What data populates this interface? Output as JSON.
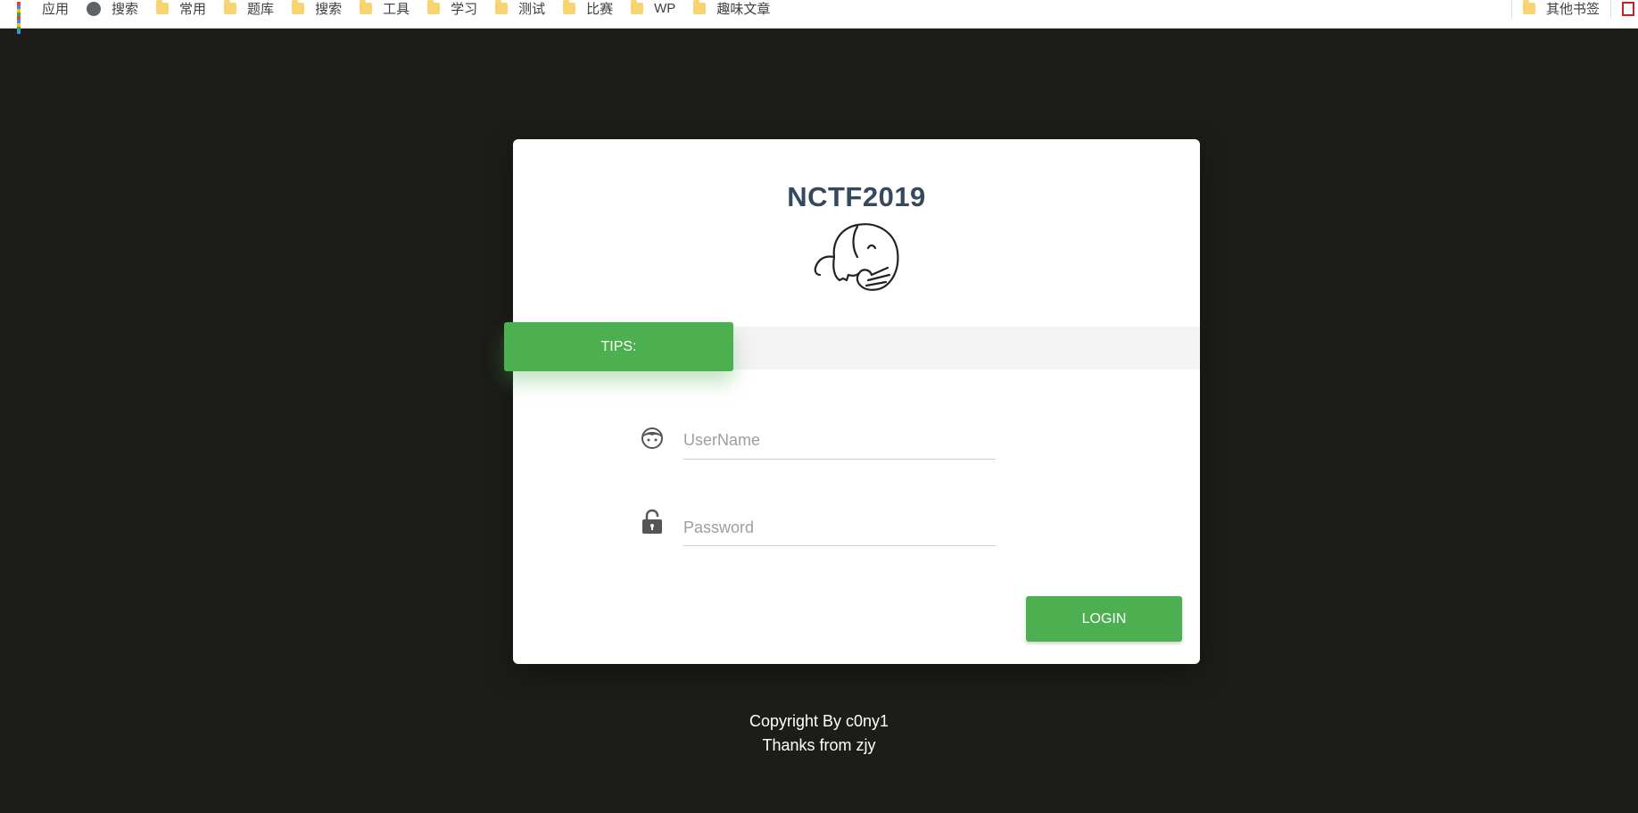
{
  "bookmarks_bar": {
    "apps_label": "应用",
    "items": [
      {
        "label": "搜索",
        "icon": "globe-icon"
      },
      {
        "label": "常用",
        "icon": "folder-icon"
      },
      {
        "label": "题库",
        "icon": "folder-icon"
      },
      {
        "label": "搜索",
        "icon": "folder-icon"
      },
      {
        "label": "工具",
        "icon": "folder-icon"
      },
      {
        "label": "学习",
        "icon": "folder-icon"
      },
      {
        "label": "测试",
        "icon": "folder-icon"
      },
      {
        "label": "比赛",
        "icon": "folder-icon"
      },
      {
        "label": "WP",
        "icon": "folder-icon"
      },
      {
        "label": "趣味文章",
        "icon": "folder-icon"
      }
    ],
    "other_bookmarks_label": "其他书签"
  },
  "login": {
    "title": "NCTF2019",
    "logo_icon": "elephant-icon",
    "tips_label": "TIPS:",
    "username": {
      "placeholder": "UserName",
      "value": "",
      "icon": "face-icon"
    },
    "password": {
      "placeholder": "Password",
      "value": "",
      "icon": "unlock-icon"
    },
    "submit_label": "LOGIN"
  },
  "footer": {
    "line1": "Copyright By c0ny1",
    "line2": "Thanks from zjy"
  },
  "colors": {
    "page_background": "#1c1c18",
    "accent_green": "#4caf50",
    "title_color": "#34495e"
  }
}
